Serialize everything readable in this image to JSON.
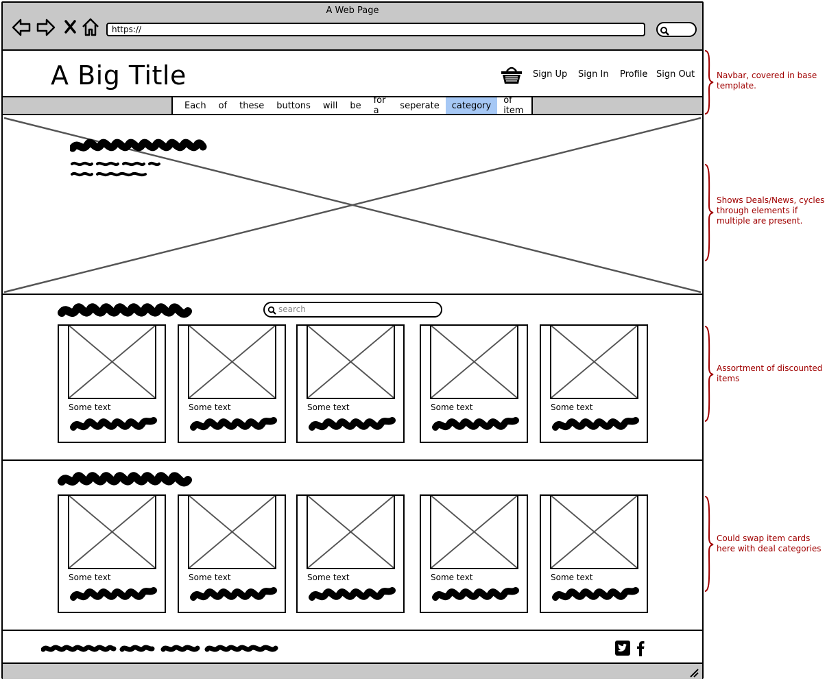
{
  "window": {
    "title": "A Web Page"
  },
  "browser": {
    "url": "https://"
  },
  "navbar": {
    "site_title": "A Big Title",
    "links": [
      "Sign Up",
      "Sign In",
      "Profile",
      "Sign Out"
    ]
  },
  "categories": {
    "items": [
      "Each",
      "of",
      "these",
      "buttons",
      "will",
      "be",
      "for a",
      "seperate",
      "category",
      "of item"
    ],
    "active": "category"
  },
  "discounted": {
    "search_placeholder": "search",
    "cards": [
      {
        "label": "Some text"
      },
      {
        "label": "Some text"
      },
      {
        "label": "Some text"
      },
      {
        "label": "Some text"
      },
      {
        "label": "Some text"
      }
    ]
  },
  "more_items": {
    "cards": [
      {
        "label": "Some text"
      },
      {
        "label": "Some text"
      },
      {
        "label": "Some text"
      },
      {
        "label": "Some text"
      },
      {
        "label": "Some text"
      }
    ]
  },
  "footer": {
    "social_icons": [
      "twitter-icon",
      "facebook-icon"
    ]
  },
  "annotations": [
    "Navbar, covered in base template.",
    "Shows Deals/News, cycles through elements if multiple are present.",
    "Assortment of discounted items",
    "Could swap item cards here with deal categories"
  ],
  "colors": {
    "chrome_gray": "#c8c8c8",
    "active_category": "#a6c8f5",
    "annotation_red": "#a00000"
  }
}
